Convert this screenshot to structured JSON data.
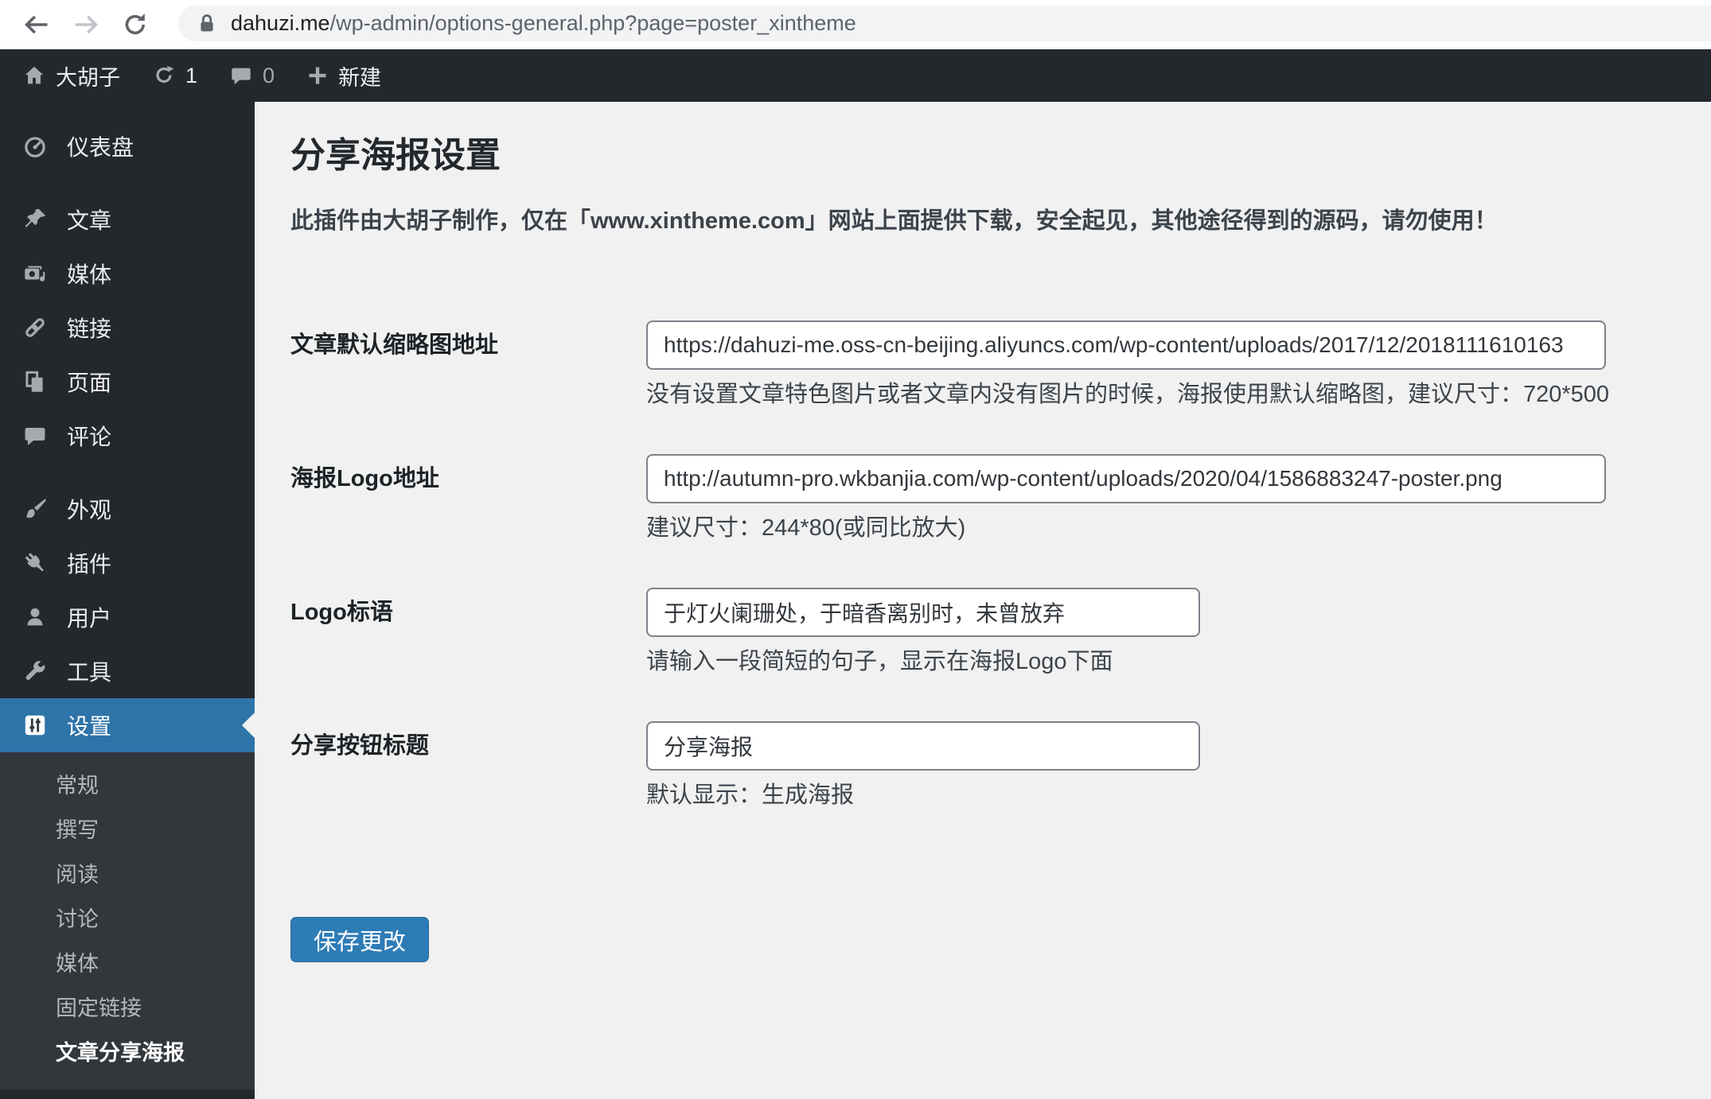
{
  "browser": {
    "url_host": "dahuzi.me",
    "url_path": "/wp-admin/options-general.php?page=poster_xintheme"
  },
  "admin_bar": {
    "site_name": "大胡子",
    "update_count": "1",
    "comment_count": "0",
    "new_label": "新建"
  },
  "sidebar": {
    "items": [
      {
        "label": "仪表盘",
        "icon": "dashboard-icon"
      },
      {
        "label": "文章",
        "icon": "pin-icon"
      },
      {
        "label": "媒体",
        "icon": "media-icon"
      },
      {
        "label": "链接",
        "icon": "link-icon"
      },
      {
        "label": "页面",
        "icon": "pages-icon"
      },
      {
        "label": "评论",
        "icon": "comment-icon"
      },
      {
        "label": "外观",
        "icon": "brush-icon"
      },
      {
        "label": "插件",
        "icon": "plugin-icon"
      },
      {
        "label": "用户",
        "icon": "user-icon"
      },
      {
        "label": "工具",
        "icon": "wrench-icon"
      },
      {
        "label": "设置",
        "icon": "settings-icon",
        "active": true
      }
    ],
    "submenu": [
      {
        "label": "常规"
      },
      {
        "label": "撰写"
      },
      {
        "label": "阅读"
      },
      {
        "label": "讨论"
      },
      {
        "label": "媒体"
      },
      {
        "label": "固定链接"
      },
      {
        "label": "文章分享海报",
        "active": true
      }
    ]
  },
  "page": {
    "title": "分享海报设置",
    "notice": "此插件由大胡子制作，仅在「www.xintheme.com」网站上面提供下载，安全起见，其他途径得到的源码，请勿使用！",
    "fields": [
      {
        "label": "文章默认缩略图地址",
        "value": "https://dahuzi-me.oss-cn-beijing.aliyuncs.com/wp-content/uploads/2017/12/2018111610163",
        "help": "没有设置文章特色图片或者文章内没有图片的时候，海报使用默认缩略图，建议尺寸：720*500"
      },
      {
        "label": "海报Logo地址",
        "value": "http://autumn-pro.wkbanjia.com/wp-content/uploads/2020/04/1586883247-poster.png",
        "help": "建议尺寸：244*80(或同比放大)"
      },
      {
        "label": "Logo标语",
        "value": "于灯火阑珊处，于暗香离别时，未曾放弃",
        "help": "请输入一段简短的句子，显示在海报Logo下面"
      },
      {
        "label": "分享按钮标题",
        "value": "分享海报",
        "help": "默认显示：生成海报"
      }
    ],
    "save_label": "保存更改"
  },
  "colors": {
    "admin_bar_bg": "#23282d",
    "submenu_bg": "#32373c",
    "active_blue": "#2e74a8",
    "button_blue": "#2d7cb6",
    "content_bg": "#f1f1f1"
  }
}
